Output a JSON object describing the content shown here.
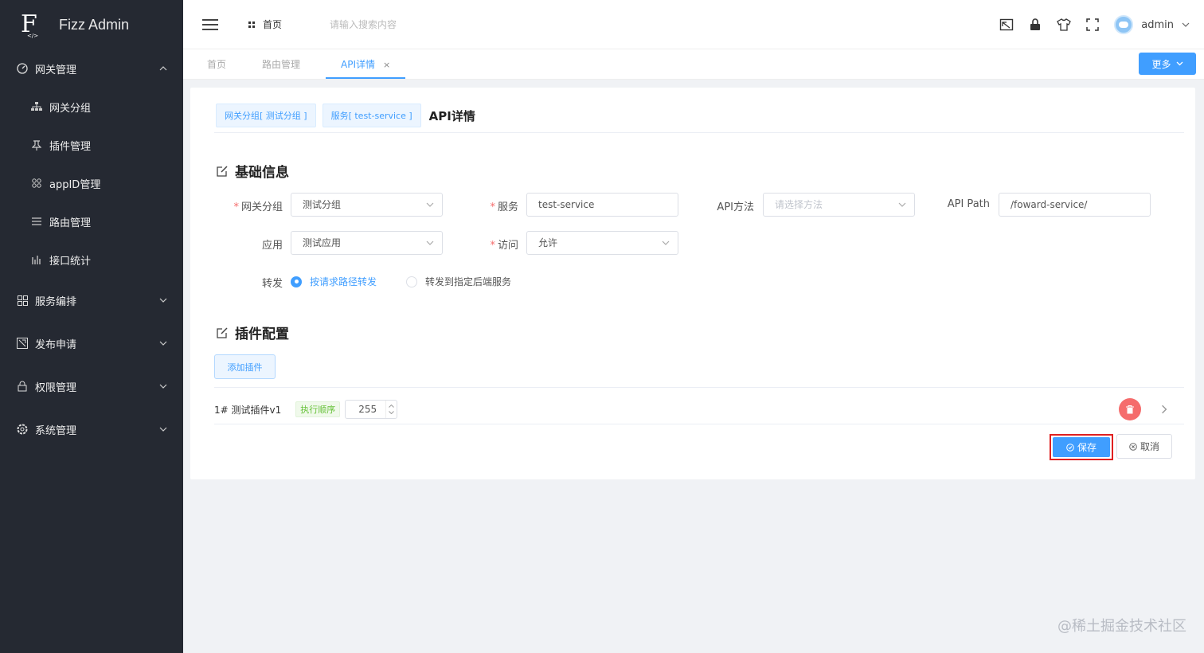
{
  "app": {
    "title": "Fizz Admin",
    "logo_sub": "</>"
  },
  "sidebar": {
    "groups": [
      {
        "label": "网关管理",
        "icon": "dashboard-icon",
        "expanded": true,
        "items": [
          {
            "label": "网关分组",
            "icon": "sitemap-icon"
          },
          {
            "label": "插件管理",
            "icon": "pin-icon"
          },
          {
            "label": "appID管理",
            "icon": "apps-icon"
          },
          {
            "label": "路由管理",
            "icon": "list-icon"
          },
          {
            "label": "接口统计",
            "icon": "stats-icon"
          }
        ]
      },
      {
        "label": "服务编排",
        "icon": "grid-icon"
      },
      {
        "label": "发布申请",
        "icon": "publish-icon"
      },
      {
        "label": "权限管理",
        "icon": "lock-icon"
      },
      {
        "label": "系统管理",
        "icon": "gear-icon"
      }
    ]
  },
  "header": {
    "home": "首页",
    "search_placeholder": "请输入搜索内容",
    "user": "admin"
  },
  "tabs": [
    {
      "label": "首页"
    },
    {
      "label": "路由管理"
    },
    {
      "label": "API详情",
      "close": "×",
      "active": true
    }
  ],
  "more_button": "更多",
  "breadcrumb": {
    "group": "网关分组[ 测试分组 ]",
    "service": "服务[ test-service ]",
    "title": "API详情"
  },
  "basic": {
    "title": "基础信息",
    "gateway_group": {
      "label": "网关分组",
      "required": "*",
      "value": "测试分组"
    },
    "service": {
      "label": "服务",
      "required": "*",
      "value": "test-service"
    },
    "api_method": {
      "label": "API方法",
      "placeholder": "请选择方法"
    },
    "api_path": {
      "label": "API Path",
      "value": "/foward-service/"
    },
    "app": {
      "label": "应用",
      "value": "测试应用"
    },
    "access": {
      "label": "访问",
      "required": "*",
      "value": "允许"
    },
    "forward": {
      "label": "转发",
      "options": [
        "按请求路径转发",
        "转发到指定后端服务"
      ],
      "selected": "按请求路径转发"
    }
  },
  "plugins": {
    "title": "插件配置",
    "add_button": "添加插件",
    "rows": [
      {
        "name": "1# 测试插件v1",
        "order_label": "执行顺序",
        "order": "255"
      }
    ]
  },
  "actions": {
    "save": "保存",
    "cancel": "取消"
  },
  "watermark": "@稀土掘金技术社区",
  "colors": {
    "primary": "#409eff",
    "sidebar": "#252932",
    "danger": "#f56c6c",
    "highlight": "#e02020"
  }
}
